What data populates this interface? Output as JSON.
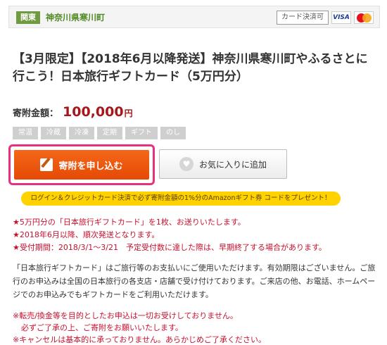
{
  "header": {
    "region_tag": "関東",
    "municipality": "神奈川県寒川町",
    "card_label": "カード決済可",
    "card_icons": [
      "visa-icon",
      "mastercard-icon"
    ]
  },
  "product": {
    "title": "【3月限定】【2018年6月以降発送】神奈川県寒川町やふるさとに行こう！日本旅行ギフトカード（5万円分）",
    "price_label": "寄附金額：",
    "price_value": "100,000",
    "price_unit": "円",
    "tags": [
      "常温",
      "冷蔵",
      "冷凍",
      "定期",
      "ギフト",
      "のし"
    ]
  },
  "actions": {
    "donate_label": "寄附を申し込む",
    "favorite_label": "お気に入りに追加"
  },
  "promo_banner": "ログイン＆クレジットカード決済で必ず寄附金額の1%分のAmazonギフト券 コードをプレゼント！",
  "notes": {
    "red_lines": [
      "★5万円分の「日本旅行ギフトカード」を1枚、お送りいたします。",
      "★2018年6月以降、順次発送となります。",
      "★受付期間：2018/3/1〜3/21　予定受付数に達した際は、早期終了する場合があります。"
    ],
    "description": "「日本旅行ギフトカード」はご旅行等のお支払いにご使用いただけます。有効期限はございません。ご旅行のお申込みは全国の日本旅行の各支店・店舗で受け付けております。ご来店の他、お電話、ホームページでのお申込みでもギフトカードをご利用いただけます。",
    "warning_lines": [
      "※転売/換金等を目的としたお申込は一切お受けしておりません。",
      "必ずご了承の上、ご寄附をお願いいたします。",
      "※キャンセルは基本的に承っておりません。あらかじめご了承ください。"
    ]
  },
  "colors": {
    "accent_green": "#6f9a40",
    "donate_orange": "#f46718",
    "highlight_pink": "#e8317d",
    "price_red": "#a8161b",
    "promo_yellow": "#ffd200"
  }
}
